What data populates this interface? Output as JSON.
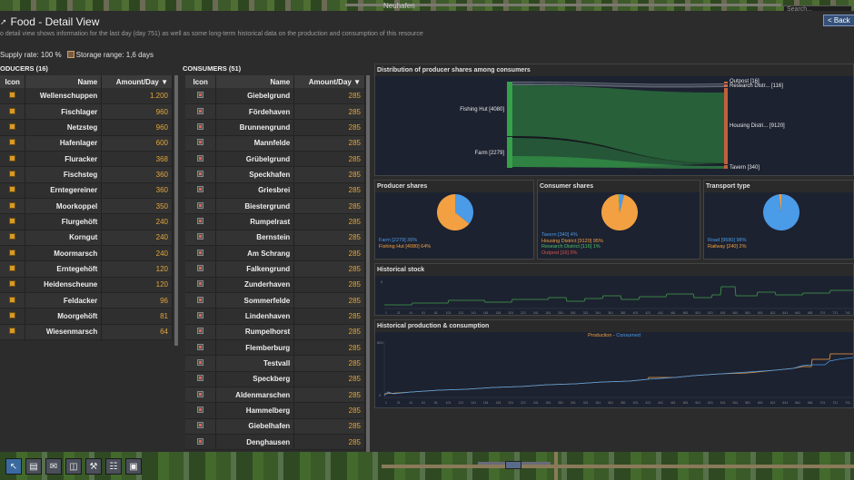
{
  "window": {
    "title": "Food - Detail View",
    "back_label": "< Back",
    "search_placeholder": "Search...",
    "city_name": "Neuhafen"
  },
  "description": "o detail view shows information for the last day (day 751) as well as some long-term historical data on the production and consumption of this resource",
  "supply_rate": "Supply rate: 100 %",
  "storage_range": "Storage range: 1,6 days",
  "producers": {
    "heading": "ODUCERS (16)",
    "columns": [
      "Icon",
      "Name",
      "Amount/Day ▼"
    ],
    "rows": [
      {
        "name": "Wellenschuppen",
        "amount": "1.200"
      },
      {
        "name": "Fischlager",
        "amount": "960"
      },
      {
        "name": "Netzsteg",
        "amount": "960"
      },
      {
        "name": "Hafenlager",
        "amount": "600"
      },
      {
        "name": "Fluracker",
        "amount": "368"
      },
      {
        "name": "Fischsteg",
        "amount": "360"
      },
      {
        "name": "Erntegereiner",
        "amount": "360"
      },
      {
        "name": "Moorkoppel",
        "amount": "350"
      },
      {
        "name": "Flurgehöft",
        "amount": "240"
      },
      {
        "name": "Korngut",
        "amount": "240"
      },
      {
        "name": "Moormarsch",
        "amount": "240"
      },
      {
        "name": "Erntegehöft",
        "amount": "120"
      },
      {
        "name": "Heidenscheune",
        "amount": "120"
      },
      {
        "name": "Feldacker",
        "amount": "96"
      },
      {
        "name": "Moorgehöft",
        "amount": "81"
      },
      {
        "name": "Wiesenmarsch",
        "amount": "64"
      }
    ]
  },
  "consumers": {
    "heading": "CONSUMERS (51)",
    "columns": [
      "Icon",
      "Name",
      "Amount/Day ▼"
    ],
    "rows": [
      {
        "name": "Giebelgrund",
        "amount": "285"
      },
      {
        "name": "Fördehaven",
        "amount": "285"
      },
      {
        "name": "Brunnengrund",
        "amount": "285"
      },
      {
        "name": "Mannfelde",
        "amount": "285"
      },
      {
        "name": "Grübelgrund",
        "amount": "285"
      },
      {
        "name": "Speckhafen",
        "amount": "285"
      },
      {
        "name": "Griesbrei",
        "amount": "285"
      },
      {
        "name": "Biestergrund",
        "amount": "285"
      },
      {
        "name": "Rumpelrast",
        "amount": "285"
      },
      {
        "name": "Bernstein",
        "amount": "285"
      },
      {
        "name": "Am Schrang",
        "amount": "285"
      },
      {
        "name": "Falkengrund",
        "amount": "285"
      },
      {
        "name": "Zunderhaven",
        "amount": "285"
      },
      {
        "name": "Sommerfelde",
        "amount": "285"
      },
      {
        "name": "Lindenhaven",
        "amount": "285"
      },
      {
        "name": "Rumpelhorst",
        "amount": "285"
      },
      {
        "name": "Flemberburg",
        "amount": "285"
      },
      {
        "name": "Testvall",
        "amount": "285"
      },
      {
        "name": "Speckberg",
        "amount": "285"
      },
      {
        "name": "Aldenmarschen",
        "amount": "285"
      },
      {
        "name": "Hammelberg",
        "amount": "285"
      },
      {
        "name": "Giebelhafen",
        "amount": "285"
      },
      {
        "name": "Denghausen",
        "amount": "285"
      }
    ]
  },
  "sankey": {
    "title": "Distribution of producer shares among consumers",
    "sources": [
      "Fishing Hut [4080]",
      "Farm [2279]"
    ],
    "targets": [
      "Outpost [16]",
      "Research Distr... [116]",
      "Housing Distri... [9120]",
      "Tavern [340]"
    ]
  },
  "producer_shares": {
    "title": "Producer shares",
    "legend": [
      "Farm [2279] 36%",
      "Fishing Hut [4080] 64%"
    ],
    "colors": [
      "#4a9be8",
      "#f2a041"
    ],
    "values": [
      36,
      64
    ]
  },
  "consumer_shares": {
    "title": "Consumer shares",
    "legend": [
      "Tavern [340] 4%",
      "Housing District [9120] 95%",
      "Research District [116] 1%",
      "Outpost [16] 0%"
    ],
    "colors": [
      "#4a9be8",
      "#f2a041",
      "#4ac26a",
      "#d9534f"
    ],
    "values": [
      4,
      95,
      1,
      0
    ]
  },
  "transport_type": {
    "title": "Transport type",
    "legend": [
      "Road [9580] 98%",
      "Railway [240] 2%"
    ],
    "colors": [
      "#4a9be8",
      "#f2a041"
    ],
    "values": [
      98,
      2
    ]
  },
  "historical_stock": {
    "title": "Historical stock",
    "y_label": "0",
    "x_ticks": [
      "1",
      "21",
      "41",
      "61",
      "81",
      "101",
      "121",
      "141",
      "161",
      "181",
      "201",
      "221",
      "241",
      "261",
      "281",
      "301",
      "321",
      "341",
      "361",
      "381",
      "401",
      "421",
      "441",
      "461",
      "481",
      "501",
      "521",
      "541",
      "561",
      "581",
      "601",
      "621",
      "641",
      "661",
      "681",
      "701",
      "721",
      "741"
    ]
  },
  "historical_pc": {
    "title": "Historical production & consumption",
    "legend_production": "Production",
    "legend_sep": " - ",
    "legend_consumed": "Consumed",
    "y_top": "600",
    "y_bottom": "0",
    "x_ticks": [
      "1",
      "21",
      "41",
      "61",
      "81",
      "101",
      "121",
      "141",
      "161",
      "181",
      "201",
      "221",
      "241",
      "261",
      "281",
      "301",
      "321",
      "341",
      "361",
      "381",
      "401",
      "421",
      "441",
      "461",
      "481",
      "501",
      "521",
      "541",
      "561",
      "581",
      "601",
      "621",
      "641",
      "661",
      "681",
      "701",
      "721",
      "741"
    ]
  }
}
